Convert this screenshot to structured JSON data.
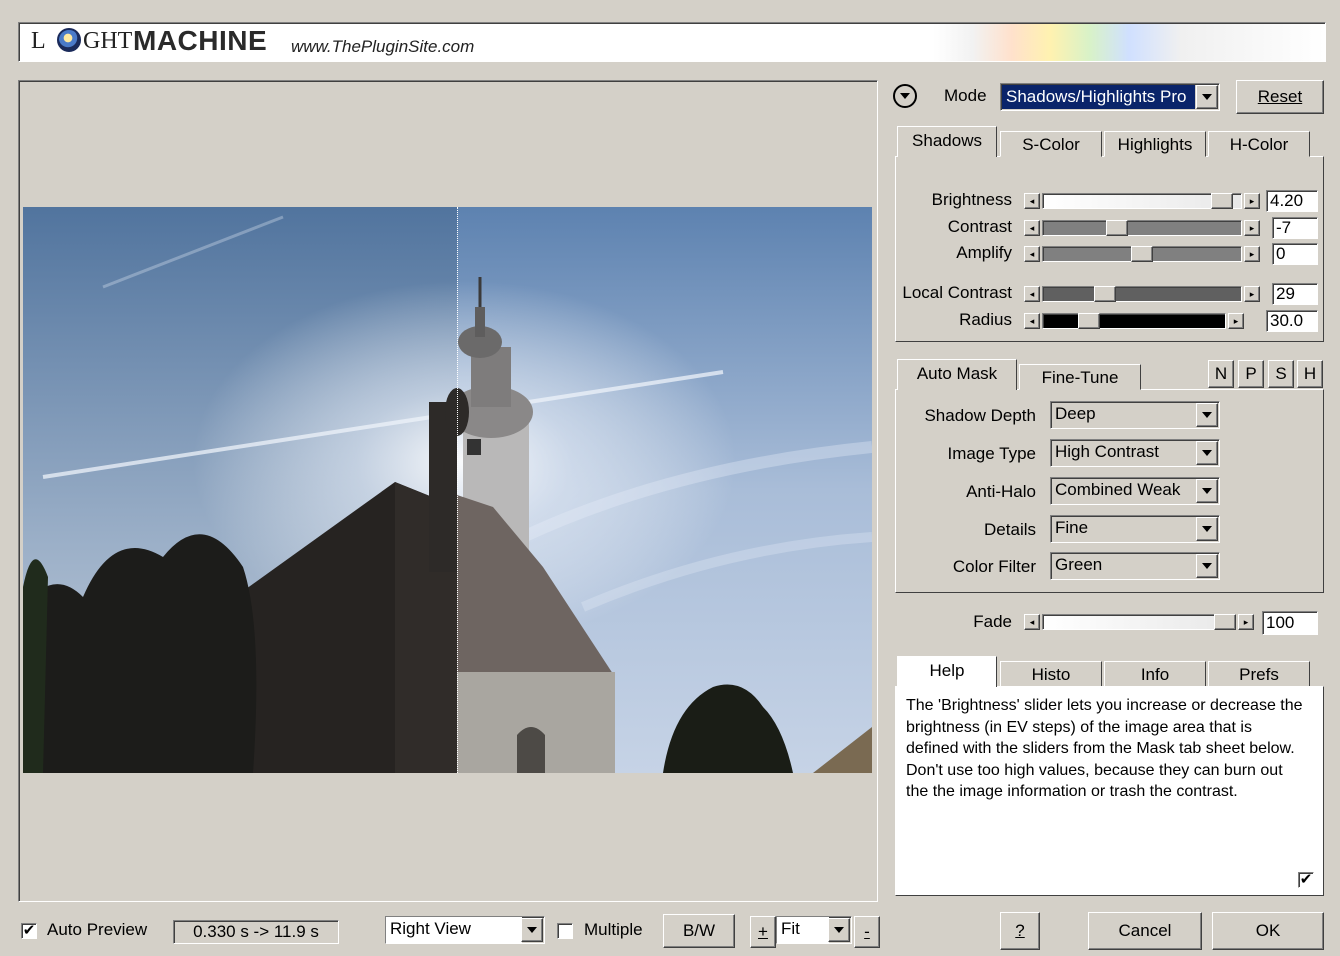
{
  "header": {
    "logo_l": "L",
    "logo_ght": "GHT",
    "logo_machine": "MACHINE",
    "url": "www.ThePluginSite.com"
  },
  "mode": {
    "label": "Mode",
    "value": "Shadows/Highlights Pro",
    "reset": "Reset"
  },
  "adjust_tabs": [
    "Shadows",
    "S-Color",
    "Highlights",
    "H-Color"
  ],
  "sliders": [
    {
      "label": "Brightness",
      "value": "4.20",
      "position": 0.95
    },
    {
      "label": "Contrast",
      "value": "-7",
      "position": 0.36
    },
    {
      "label": "Amplify",
      "value": "0",
      "position": 0.5
    },
    {
      "label": "Local Contrast",
      "value": "29",
      "position": 0.29
    },
    {
      "label": "Radius",
      "value": "30.0",
      "position": 0.22
    }
  ],
  "mask_tabs": [
    "Auto Mask",
    "Fine-Tune"
  ],
  "mask_buttons": [
    "N",
    "P",
    "S",
    "H"
  ],
  "mask_fields": [
    {
      "label": "Shadow Depth",
      "value": "Deep"
    },
    {
      "label": "Image Type",
      "value": "High Contrast"
    },
    {
      "label": "Anti-Halo",
      "value": "Combined Weak"
    },
    {
      "label": "Details",
      "value": "Fine"
    },
    {
      "label": "Color Filter",
      "value": "Green"
    }
  ],
  "fade": {
    "label": "Fade",
    "value": "100",
    "position": 1.0
  },
  "info_tabs": [
    "Help",
    "Histo",
    "Info",
    "Prefs"
  ],
  "help_text": "The 'Brightness' slider lets you increase or decrease the brightness (in EV steps) of the image area that is defined with the sliders from the Mask tab sheet below. Don't use too high values, because they can burn out the the image information or trash the contrast.",
  "help_checked": true,
  "bottom": {
    "auto_preview_label": "Auto Preview",
    "auto_preview_checked": true,
    "timing": "0.330 s -> 11.9 s",
    "view": "Right View",
    "multiple_label": "Multiple",
    "multiple_checked": false,
    "bw": "B/W",
    "zoom_in": "+",
    "zoom": "Fit",
    "zoom_out": "-",
    "help": "?",
    "cancel": "Cancel",
    "ok": "OK"
  }
}
